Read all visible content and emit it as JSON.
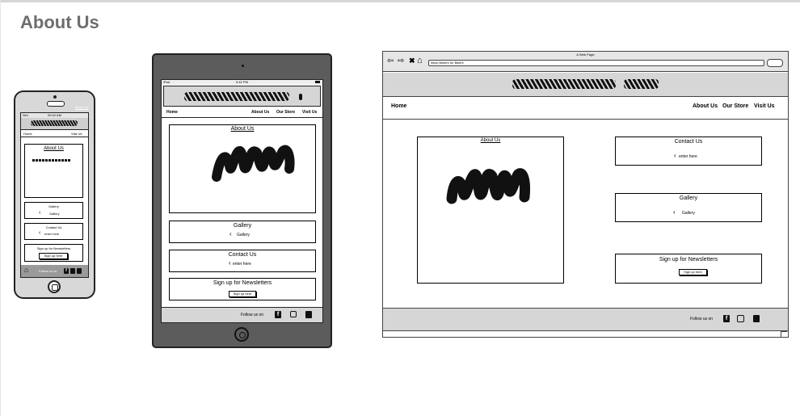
{
  "page": {
    "title": "About Us"
  },
  "phone": {
    "corner_link": "About Us",
    "status_left": "Sim",
    "status_time": "09:42 AM",
    "nav": [
      "Home",
      "Visit Us"
    ],
    "about_title": "About Us",
    "gallery_title": "Gallery",
    "gallery_link": "Gallery",
    "contact_title": "Contact Us",
    "contact_link": "enter here",
    "newsletter_title": "Sign up for Newsletters",
    "newsletter_button": "Sign up here",
    "footer_text": "Follow us on"
  },
  "tablet": {
    "status_left": "iPad",
    "status_time": "9:42 PM",
    "nav_home": "Home",
    "nav_links": [
      "About Us",
      "Our Store",
      "Visit Us"
    ],
    "about_title": "About Us",
    "gallery_title": "Gallery",
    "gallery_link": "Gallery",
    "contact_title": "Contact Us",
    "contact_link": "enter here",
    "newsletter_title": "Sign up for Newsletters",
    "newsletter_button": "Sign up here",
    "footer_text": "Follow us on"
  },
  "browser": {
    "window_title": "A Web Page",
    "url": "https://bikers for Bikers",
    "nav_home": "Home",
    "nav_links": [
      "About Us",
      "Our Store",
      "Visit Us"
    ],
    "about_title": "About Us",
    "contact_title": "Contact Us",
    "contact_link": "enter here",
    "gallery_title": "Gallery",
    "gallery_link": "Gallery",
    "newsletter_title": "Sign up for Newsletters",
    "newsletter_button": "Sign up here",
    "footer_text": "Follow us on"
  },
  "icons": [
    "facebook-icon",
    "instagram-icon",
    "twitter-icon",
    "home-icon",
    "chevron-left-icon"
  ]
}
